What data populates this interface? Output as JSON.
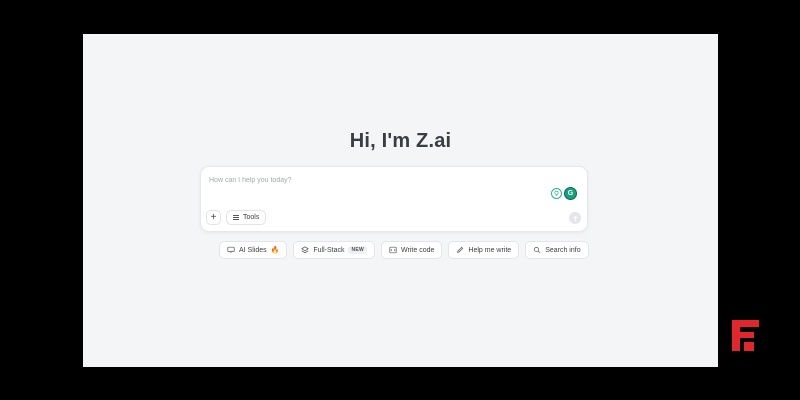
{
  "greeting": "Hi, I'm Z.ai",
  "chat": {
    "placeholder": "How can I help you today?",
    "grammarly_letter": "G",
    "plus_label": "+",
    "tools_label": "Tools"
  },
  "suggestions": {
    "ai_slides": "AI Slides",
    "ai_slides_emoji": "🔥",
    "full_stack": "Full-Stack",
    "full_stack_badge": "NEW",
    "write_code": "Write code",
    "help_me_write": "Help me write",
    "search_info": "Search info"
  },
  "colors": {
    "background": "#f4f5f7",
    "brand_logo": "#e2262d",
    "grammarly": "#15a37e"
  }
}
